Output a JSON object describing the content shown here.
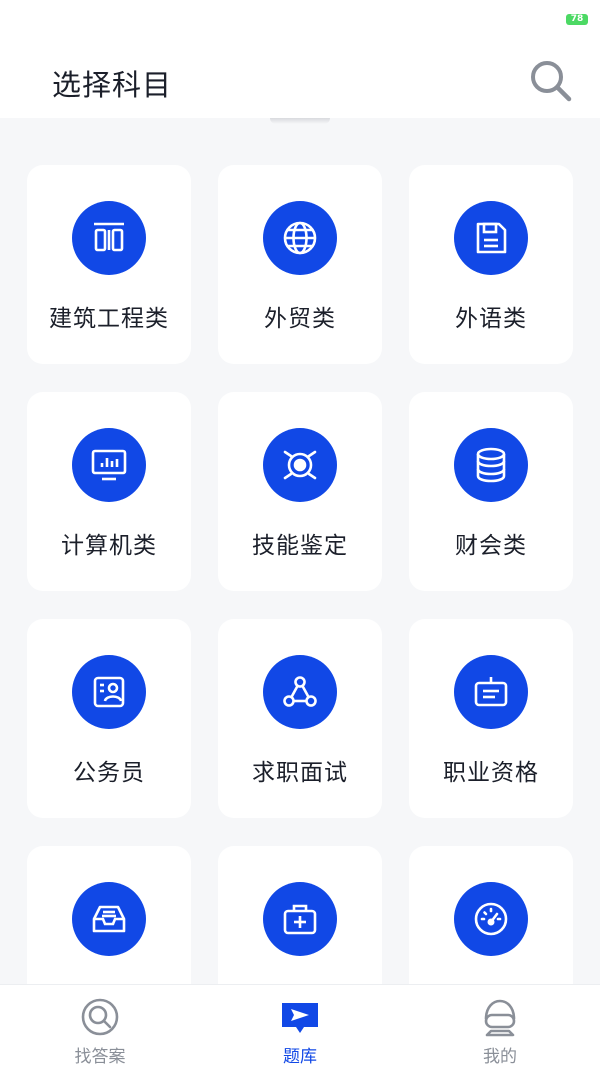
{
  "status_bar": {
    "battery": "78",
    "battery_color": "#4cd964"
  },
  "header": {
    "title": "选择科目"
  },
  "colors": {
    "accent": "#1148e6",
    "text": "#1b1f2a",
    "muted": "#8a8f98"
  },
  "subjects": [
    {
      "label": "建筑工程类",
      "icon": "building-icon"
    },
    {
      "label": "外贸类",
      "icon": "globe-icon"
    },
    {
      "label": "外语类",
      "icon": "floppy-disk-icon"
    },
    {
      "label": "计算机类",
      "icon": "monitor-chart-icon"
    },
    {
      "label": "技能鉴定",
      "icon": "target-icon"
    },
    {
      "label": "财会类",
      "icon": "database-icon"
    },
    {
      "label": "公务员",
      "icon": "id-card-icon"
    },
    {
      "label": "求职面试",
      "icon": "share-network-icon"
    },
    {
      "label": "职业资格",
      "icon": "badge-icon"
    },
    {
      "label": "",
      "icon": "inbox-tray-icon"
    },
    {
      "label": "",
      "icon": "medical-kit-icon"
    },
    {
      "label": "",
      "icon": "speedometer-icon"
    }
  ],
  "tabbar": {
    "tabs": [
      {
        "label": "找答案",
        "icon": "search-answer-icon",
        "active": false
      },
      {
        "label": "题库",
        "icon": "question-bank-icon",
        "active": true
      },
      {
        "label": "我的",
        "icon": "profile-icon",
        "active": false
      }
    ]
  }
}
